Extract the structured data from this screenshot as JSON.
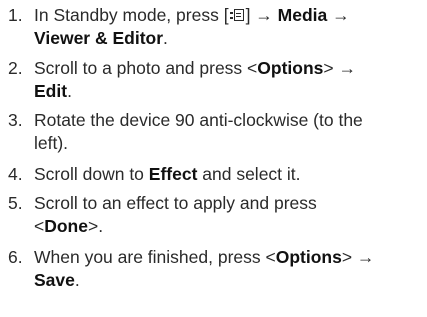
{
  "steps": [
    {
      "num": "1.",
      "line1": {
        "t1": "In Standby mode, press [",
        "icon": "menu-key-icon",
        "t2": "] → ",
        "b1": "Media",
        "t3": " →"
      },
      "line2": {
        "b1": "Viewer & Editor",
        "t1": "."
      }
    },
    {
      "num": "2.",
      "line1": {
        "t1": "Scroll to a photo and press <",
        "b1": "Options",
        "t2": "> →"
      },
      "line2": {
        "b1": "Edit",
        "t1": "."
      }
    },
    {
      "num": "3.",
      "line1": {
        "t1": "Rotate the device 90 anti-clockwise (to the"
      },
      "line2": {
        "t1": "left)."
      }
    },
    {
      "num": "4.",
      "line1": {
        "t1": "Scroll down to ",
        "b1": "Effect",
        "t2": " and select it."
      }
    },
    {
      "num": "5.",
      "line1": {
        "t1": "Scroll to an effect to apply and press"
      },
      "line2": {
        "t1": "<",
        "b1": "Done",
        "t2": ">."
      }
    },
    {
      "num": "6.",
      "line1": {
        "t1": "When you are finished, press <",
        "b1": "Options",
        "t2": "> →"
      },
      "line2": {
        "b1": "Save",
        "t1": "."
      }
    }
  ]
}
